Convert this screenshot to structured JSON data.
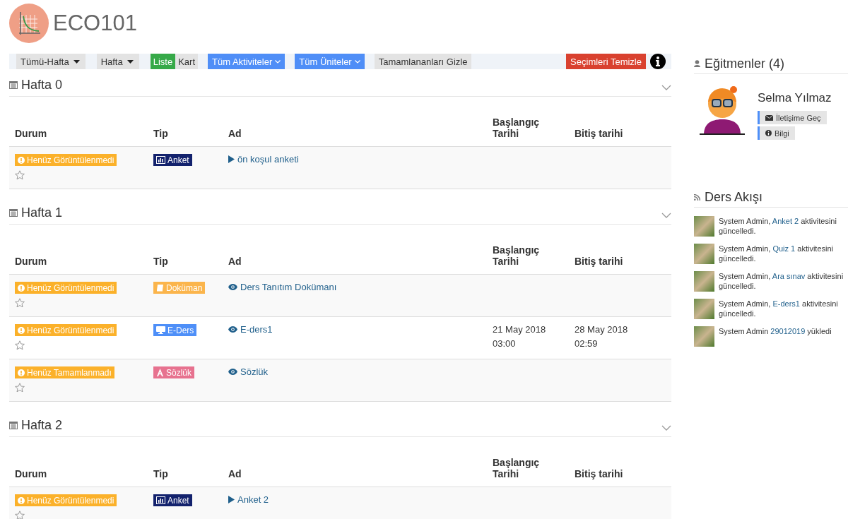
{
  "course": {
    "title": "ECO101"
  },
  "filters": {
    "week_range": "Tümü-Hafta",
    "period": "Hafta",
    "views": [
      {
        "label": "Liste",
        "selected": true
      },
      {
        "label": "Kart",
        "selected": false
      }
    ],
    "activities": "Tüm Aktiviteler",
    "units": "Tüm Üniteler",
    "hide_completed": "Tamamlananları Gizle",
    "clear": "Seçimleri Temizle"
  },
  "weeks": [
    {
      "title": "Hafta 0",
      "expanded": true,
      "columns": [
        "Durum",
        "Tip",
        "Ad",
        "Başlangıç Tarihi",
        "Bitiş tarihi"
      ],
      "rows": [
        {
          "status": "Henüz Görüntülenmedi",
          "type": "Anket",
          "kind": "survey",
          "activity": {
            "kind": "play",
            "label": "ön koşul anketi"
          },
          "favorite": false
        }
      ]
    },
    {
      "title": "Hafta 1",
      "expanded": true,
      "columns": [
        "Durum",
        "Tip",
        "Ad",
        "Başlangıç Tarihi",
        "Bitiş tarihi"
      ],
      "rows": [
        {
          "status": "Henüz Görüntülenmedi",
          "type": "Doküman",
          "kind": "document",
          "activity": {
            "kind": "view",
            "label": "Ders Tanıtım Dokümanı"
          },
          "favorite": false
        },
        {
          "status": "Henüz Görüntülenmedi",
          "type": "E-Ders",
          "kind": "elesson",
          "activity": {
            "kind": "view",
            "label": "E-ders1"
          },
          "start": "21 May 2018 03:00",
          "end": "28 May 2018 02:59",
          "favorite": false
        },
        {
          "status": "Henüz Tamamlanmadı",
          "type": "Sözlük",
          "kind": "glossary",
          "activity": {
            "kind": "view",
            "label": "Sözlük"
          },
          "favorite": false
        }
      ]
    },
    {
      "title": "Hafta 2",
      "expanded": true,
      "columns": [
        "Durum",
        "Tip",
        "Ad",
        "Başlangıç Tarihi",
        "Bitiş tarihi"
      ],
      "rows": [
        {
          "status": "Henüz Görüntülenmedi",
          "type": "Anket",
          "kind": "survey",
          "activity": {
            "kind": "play",
            "label": "Anket 2"
          },
          "favorite": false
        }
      ]
    }
  ],
  "instructors": {
    "title": "Eğitmenler (4)",
    "name": "Selma Yılmaz",
    "contact": "İletişime Geç",
    "info": "Bilgi"
  },
  "feed": {
    "title": "Ders Akışı",
    "items": [
      {
        "before": "System Admin, ",
        "link": "Anket 2",
        "after": " aktivitesini güncelledi."
      },
      {
        "before": "System Admin, ",
        "link": "Quiz 1",
        "after": " aktivitesini güncelledi."
      },
      {
        "before": "System Admin, ",
        "link": "Ara sınav",
        "after": " aktivitesini güncelledi."
      },
      {
        "before": "System Admin, ",
        "link": "E-ders1",
        "after": " aktivitesini güncelledi."
      },
      {
        "before": "System Admin ",
        "link": "29012019",
        "after": " yükledi"
      }
    ]
  }
}
